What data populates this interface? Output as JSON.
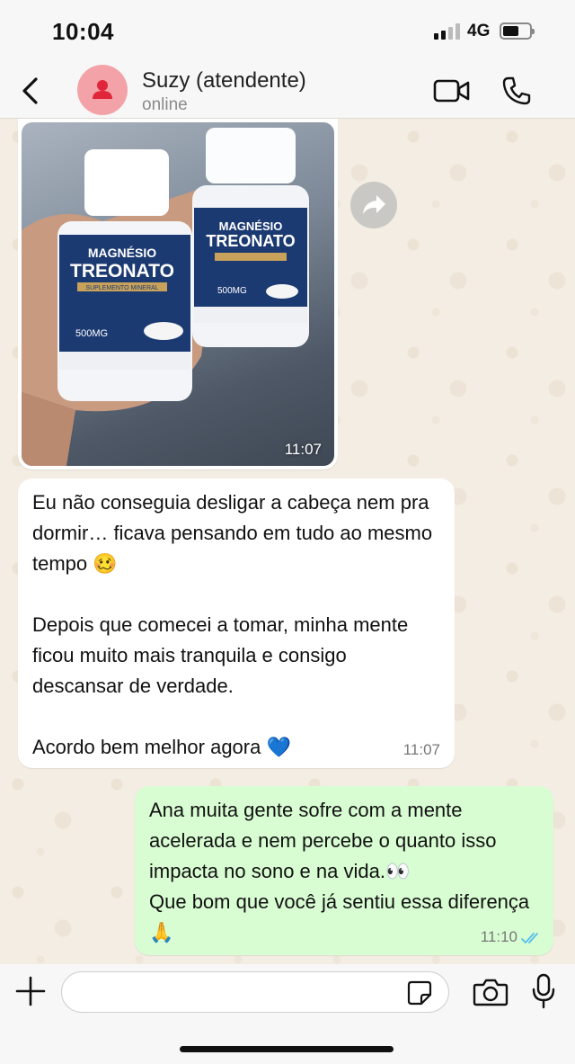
{
  "status_bar": {
    "time": "10:04",
    "network": "4G",
    "signal_bars_active": 2,
    "signal_bars_total": 4,
    "battery_level": 0.55
  },
  "header": {
    "contact_name": "Suzy (atendente)",
    "contact_status": "online",
    "avatar_icon": "person-icon",
    "avatar_color": "#f3a3a8",
    "avatar_icon_color": "#e0263a"
  },
  "messages": [
    {
      "type": "image",
      "direction": "incoming",
      "time": "11:07",
      "image_labels": {
        "product_line1": "MAGNÉSIO",
        "product_line2": "TREONATO",
        "product_tag": "SUPLEMENTO MINERAL",
        "dose": "500MG"
      }
    },
    {
      "type": "text",
      "direction": "incoming",
      "text": "Eu não conseguia desligar a cabeça nem pra dormir… ficava pensando em tudo ao mesmo tempo 🥴\n\nDepois que comecei a tomar, minha mente ficou muito mais tranquila e consigo descansar de verdade.\n\nAcordo bem melhor agora 💙",
      "time": "11:07"
    },
    {
      "type": "text",
      "direction": "outgoing",
      "text": "Ana muita gente sofre com a mente acelerada e nem percebe o quanto isso impacta no sono e na vida.👀\nQue bom que você já sentiu essa diferença 🙏",
      "time": "11:10",
      "read": true
    }
  ],
  "input": {
    "value": "",
    "placeholder": ""
  },
  "colors": {
    "incoming_bubble": "#ffffff",
    "outgoing_bubble": "#d9fdd3",
    "read_ticks": "#53bdeb",
    "chat_background": "#f3ede3"
  }
}
